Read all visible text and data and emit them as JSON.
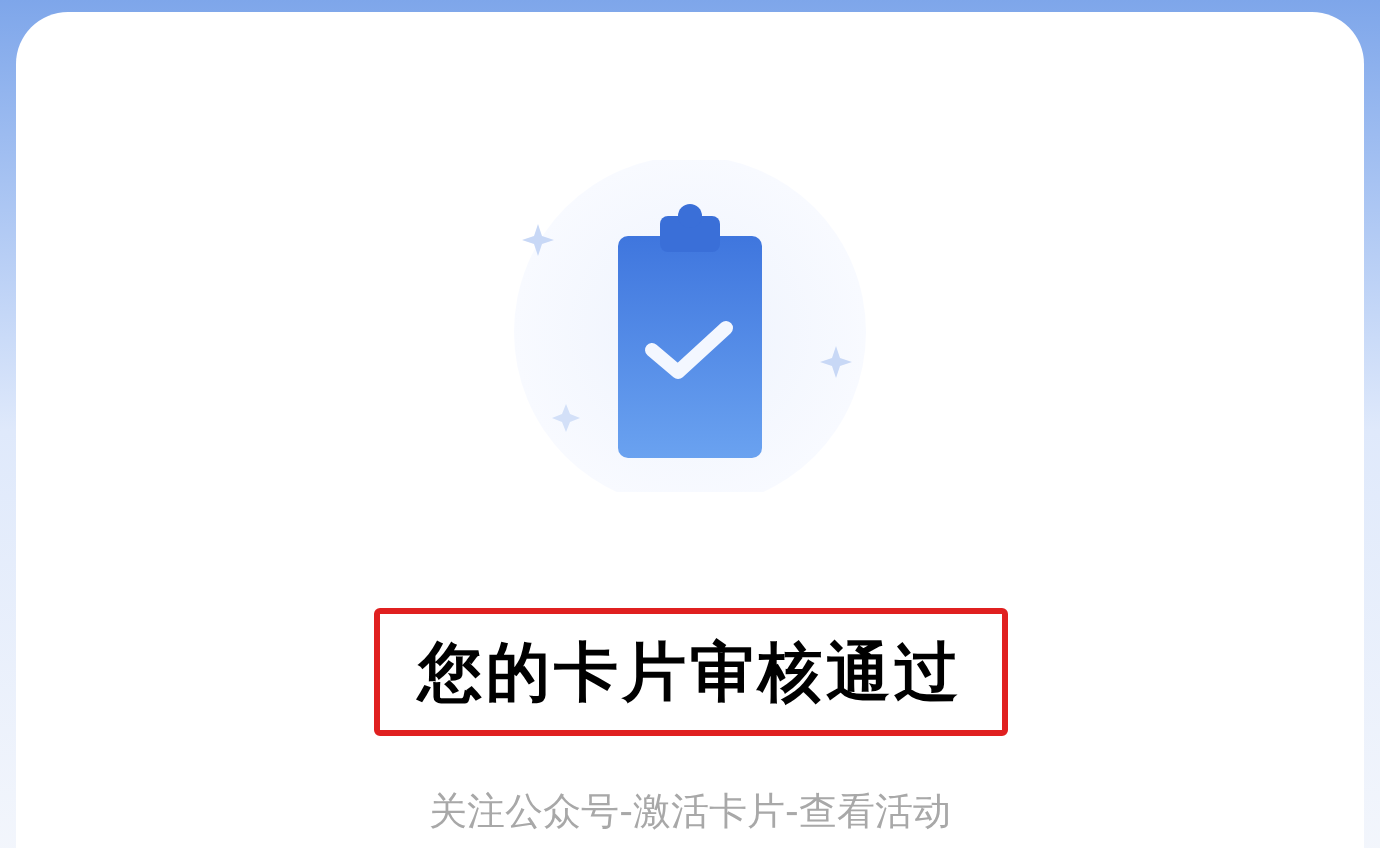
{
  "title": {
    "text": "您的卡片审核通过",
    "highlighted": true
  },
  "subtitle": "关注公众号-激活卡片-查看活动"
}
